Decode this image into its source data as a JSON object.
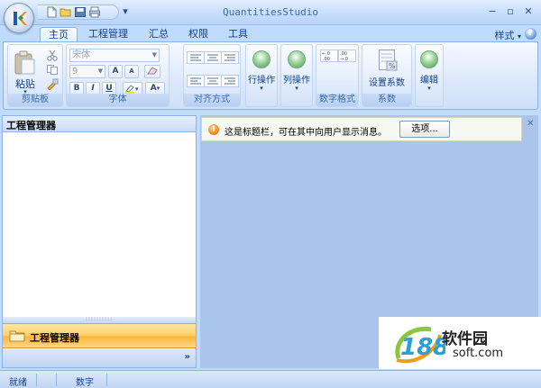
{
  "window": {
    "title": "QuantitiesStudio",
    "minimize": "−",
    "restore": "▫",
    "close": "✕"
  },
  "qat": {
    "icons": [
      "new-document-icon",
      "open-folder-icon",
      "save-icon",
      "print-icon",
      "customize-qat-icon"
    ],
    "dropdown": "▾"
  },
  "tabs": [
    {
      "label": "主页",
      "active": true
    },
    {
      "label": "工程管理",
      "active": false
    },
    {
      "label": "汇总",
      "active": false
    },
    {
      "label": "权限",
      "active": false
    },
    {
      "label": "工具",
      "active": false
    }
  ],
  "style_menu": "样式",
  "style_menu_arrow": "▾",
  "help": "?",
  "ribbon": {
    "clipboard": {
      "label": "剪贴板",
      "paste": "粘贴"
    },
    "font": {
      "label": "字体",
      "font_name": "宋体",
      "font_size": "9",
      "bold": "B",
      "italic": "I",
      "underline": "U",
      "grow": "A",
      "shrink": "A",
      "color": "A"
    },
    "align": {
      "label": "对齐方式"
    },
    "row_ops": {
      "label": "行操作"
    },
    "col_ops": {
      "label": "列操作"
    },
    "number_format": {
      "label": "数字格式"
    },
    "coefficient": {
      "label": "系数",
      "set_coefficient": "设置系数"
    },
    "edit": {
      "label": "编辑"
    }
  },
  "left_panel": {
    "header": "工程管理器",
    "splitter_grip": "::::::::::",
    "nav_item": "工程管理器",
    "footer_chevron": "»"
  },
  "infobar": {
    "icon": "!",
    "message": "这是标题栏，可在其中向用户显示消息。",
    "button": "选项...",
    "close": "✕"
  },
  "statusbar": {
    "ready": "就绪",
    "num": "数字"
  },
  "watermark": {
    "number": "188",
    "title": "软件园",
    "domain": "soft.com"
  }
}
